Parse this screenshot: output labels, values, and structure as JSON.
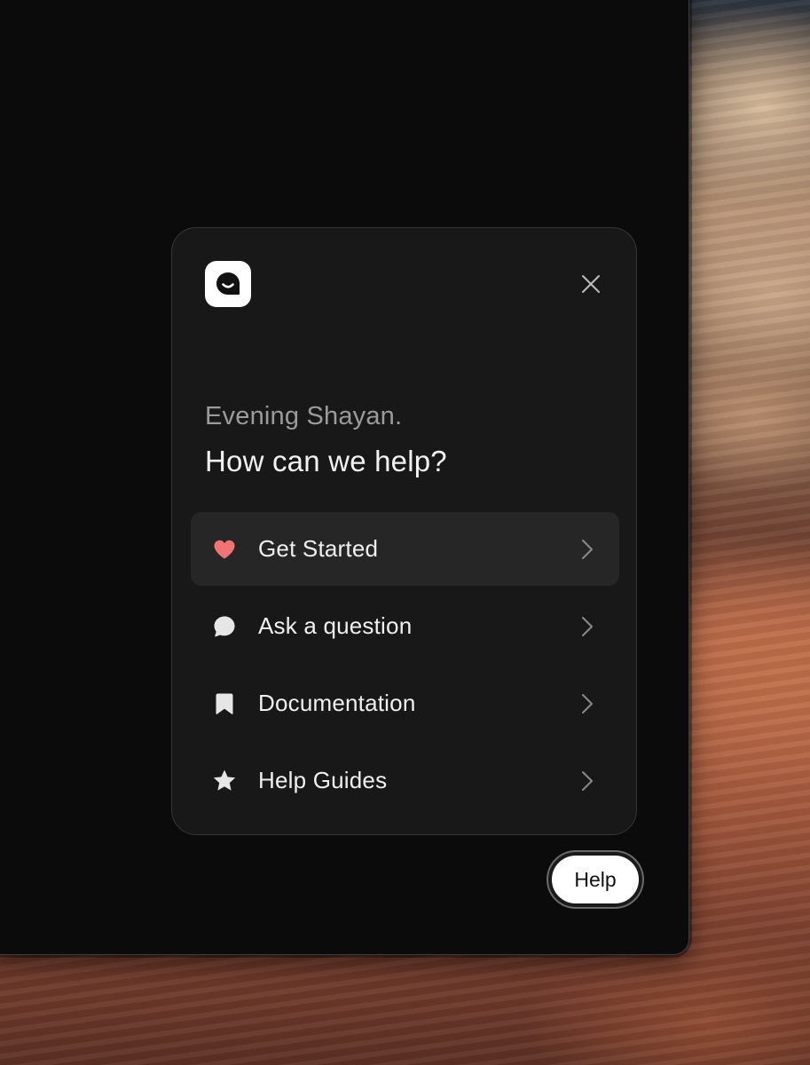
{
  "popup": {
    "greeting": "Evening Shayan.",
    "question": "How can we help?",
    "logo_icon": "chat-smile-icon",
    "close_icon": "close-icon",
    "menu": [
      {
        "label": "Get Started",
        "icon": "heart-icon",
        "icon_color": "#f07474",
        "active": true
      },
      {
        "label": "Ask a question",
        "icon": "chat-bubble-icon",
        "icon_color": "#e6e6e6",
        "active": false
      },
      {
        "label": "Documentation",
        "icon": "bookmark-icon",
        "icon_color": "#e6e6e6",
        "active": false
      },
      {
        "label": "Help Guides",
        "icon": "star-icon",
        "icon_color": "#e6e6e6",
        "active": false
      }
    ]
  },
  "help_button": {
    "label": "Help"
  },
  "colors": {
    "window_bg": "#0b0b0b",
    "popup_bg": "#181818",
    "active_item_bg": "#262626",
    "accent_heart": "#f07474"
  }
}
